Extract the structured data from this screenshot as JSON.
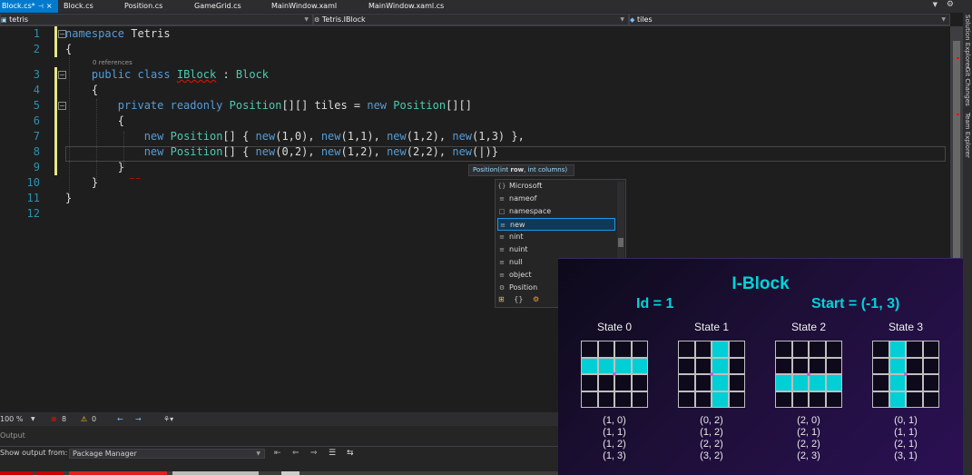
{
  "tabs": [
    {
      "label": "Block.cs*",
      "active": true
    },
    {
      "label": "Block.cs",
      "active": false
    },
    {
      "label": "Position.cs",
      "active": false
    },
    {
      "label": "GameGrid.cs",
      "active": false
    },
    {
      "label": "MainWindow.xaml",
      "active": false
    },
    {
      "label": "MainWindow.xaml.cs",
      "active": false
    }
  ],
  "navbar": {
    "project": "tetris",
    "type": "Tetris.IBlock",
    "member": "tiles"
  },
  "editor": {
    "line_numbers": [
      "1",
      "2",
      "3",
      "4",
      "5",
      "6",
      "7",
      "8",
      "9",
      "10",
      "11",
      "12"
    ],
    "codelens": "0 references",
    "current_line": 8
  },
  "param_info": {
    "method": "Position(",
    "param1_type": "int",
    "param1_name": "row",
    "sep": ", ",
    "param2_type": "int",
    "param2_name": "columns",
    "close": ")"
  },
  "completion": {
    "items": [
      {
        "label": "Microsoft",
        "icon": "namespace-icon",
        "glyph": "{}"
      },
      {
        "label": "nameof",
        "icon": "keyword-icon",
        "glyph": "≡"
      },
      {
        "label": "namespace",
        "icon": "snippet-icon",
        "glyph": "□"
      },
      {
        "label": "new",
        "icon": "keyword-icon",
        "glyph": "≡",
        "selected": true
      },
      {
        "label": "nint",
        "icon": "keyword-icon",
        "glyph": "≡"
      },
      {
        "label": "nuint",
        "icon": "keyword-icon",
        "glyph": "≡"
      },
      {
        "label": "null",
        "icon": "keyword-icon",
        "glyph": "≡"
      },
      {
        "label": "object",
        "icon": "keyword-icon",
        "glyph": "≡"
      },
      {
        "label": "Position",
        "icon": "class-icon",
        "glyph": "⚙"
      }
    ]
  },
  "status": {
    "zoom": "100 %",
    "errors": "8",
    "warnings": "0"
  },
  "output": {
    "title": "Output",
    "show_from_label": "Show output from:",
    "source": "Package Manager"
  },
  "vertical_tabs": [
    "Solution Explorer",
    "Git Changes",
    "Team Explorer"
  ],
  "overlay": {
    "title": "I-Block",
    "id_text": "Id = 1",
    "start_text": "Start = (-1, 3)",
    "states": [
      {
        "label": "State 0",
        "cells": [
          [
            1,
            0
          ],
          [
            1,
            1
          ],
          [
            1,
            2
          ],
          [
            1,
            3
          ]
        ],
        "positions": [
          "(1, 0)",
          "(1, 1)",
          "(1, 2)",
          "(1, 3)"
        ]
      },
      {
        "label": "State 1",
        "cells": [
          [
            0,
            2
          ],
          [
            1,
            2
          ],
          [
            2,
            2
          ],
          [
            3,
            2
          ]
        ],
        "positions": [
          "(0, 2)",
          "(1, 2)",
          "(2, 2)",
          "(3, 2)"
        ]
      },
      {
        "label": "State 2",
        "cells": [
          [
            2,
            0
          ],
          [
            2,
            1
          ],
          [
            2,
            2
          ],
          [
            2,
            3
          ]
        ],
        "positions": [
          "(2, 0)",
          "(2, 1)",
          "(2, 2)",
          "(2, 3)"
        ]
      },
      {
        "label": "State 3",
        "cells": [
          [
            0,
            1
          ],
          [
            1,
            1
          ],
          [
            2,
            1
          ],
          [
            3,
            1
          ]
        ],
        "positions": [
          "(0, 1)",
          "(1, 1)",
          "(2, 1)",
          "(3, 1)"
        ]
      }
    ],
    "accent_color": "#00cfd5"
  },
  "colors": {
    "accent_tab": "#007acc",
    "keyword": "#569cd6",
    "type": "#4ec9b0",
    "error": "#e51400"
  }
}
